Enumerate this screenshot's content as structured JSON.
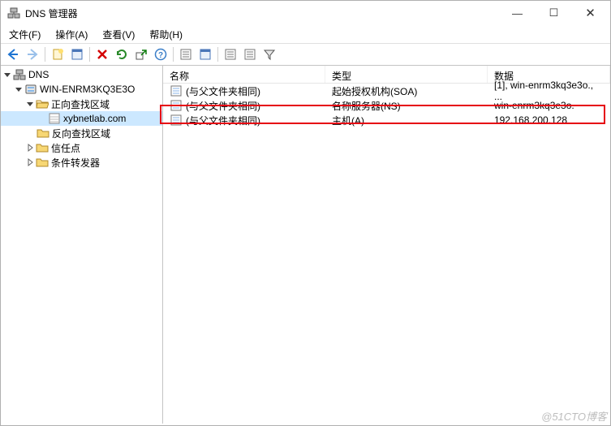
{
  "window": {
    "title": "DNS 管理器",
    "minimize": "—",
    "maximize": "☐",
    "close": "✕"
  },
  "menu": {
    "file": "文件(F)",
    "action": "操作(A)",
    "view": "查看(V)",
    "help": "帮助(H)"
  },
  "tree": {
    "root": "DNS",
    "server": "WIN-ENRM3KQ3E3O",
    "fwd": "正向查找区域",
    "zone": "xybnetlab.com",
    "rev": "反向查找区域",
    "trust": "信任点",
    "cond": "条件转发器"
  },
  "columns": {
    "name": "名称",
    "type": "类型",
    "data": "数据"
  },
  "records": [
    {
      "name": "(与父文件夹相同)",
      "type": "起始授权机构(SOA)",
      "data": "[1], win-enrm3kq3e3o., ..."
    },
    {
      "name": "(与父文件夹相同)",
      "type": "名称服务器(NS)",
      "data": "win-enrm3kq3e3o."
    },
    {
      "name": "(与父文件夹相同)",
      "type": "主机(A)",
      "data": "192.168.200.128"
    }
  ],
  "watermark": "@51CTO博客"
}
